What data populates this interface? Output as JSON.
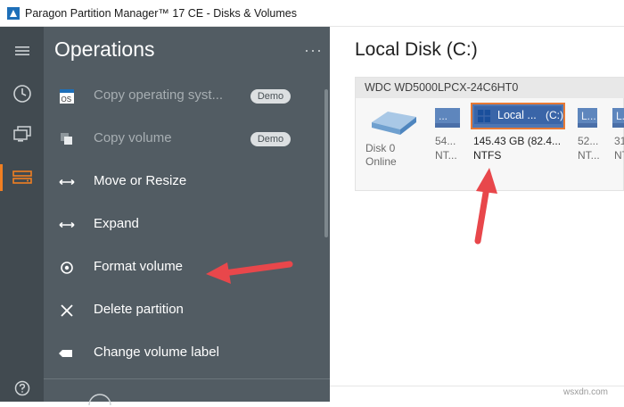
{
  "window": {
    "title": "Paragon Partition Manager™ 17 CE - Disks & Volumes"
  },
  "operations": {
    "title": "Operations",
    "more": "···",
    "items": [
      {
        "label": "Copy operating syst...",
        "badge": "Demo",
        "icon": "os-icon",
        "disabled": true
      },
      {
        "label": "Copy volume",
        "badge": "Demo",
        "icon": "copy-icon",
        "disabled": true
      },
      {
        "label": "Move or Resize",
        "icon": "resize-arrows-icon"
      },
      {
        "label": "Expand",
        "icon": "expand-arrows-icon"
      },
      {
        "label": "Format volume",
        "icon": "format-icon"
      },
      {
        "label": "Delete partition",
        "icon": "delete-icon"
      },
      {
        "label": "Change volume label",
        "icon": "label-icon"
      }
    ]
  },
  "main": {
    "title": "Local Disk (C:)",
    "disk": {
      "header": "WDC WD5000LPCX-24C6HT0",
      "name": "Disk 0",
      "status": "Online",
      "volumes": [
        {
          "label": "...",
          "size": "54...",
          "fs": "NT..."
        },
        {
          "label": "Local ...",
          "drive": "(C:)",
          "size": "145.43 GB (82.4...",
          "fs": "NTFS",
          "selected": true
        },
        {
          "label": "L...",
          "size": "52...",
          "fs": "NT..."
        },
        {
          "label": "L...",
          "size": "31",
          "fs": "NT"
        }
      ]
    }
  },
  "watermark": "wsxdn.com",
  "colors": {
    "accent": "#f07f22",
    "rail": "#414a50",
    "panel": "#525c63",
    "volume": "#5e86bd",
    "selected_border": "#e87a35",
    "arrow": "#e8474b"
  }
}
